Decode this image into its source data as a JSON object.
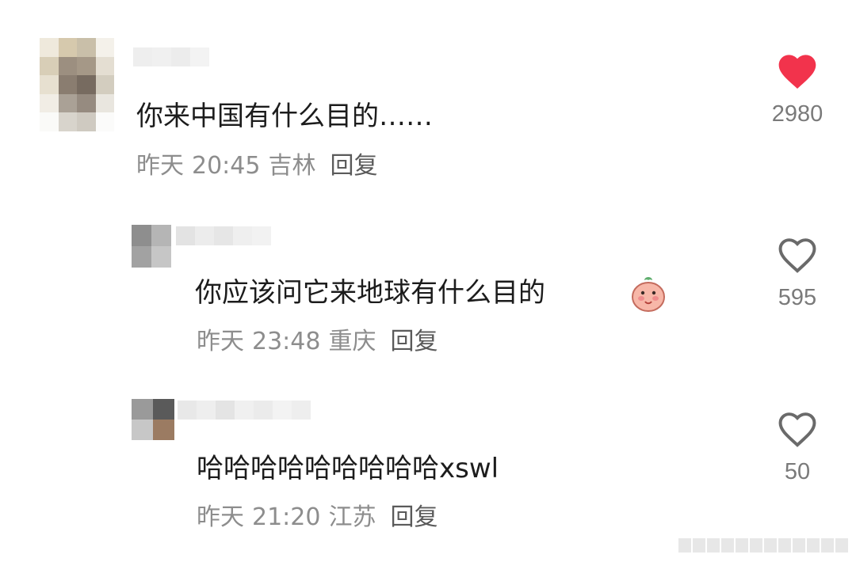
{
  "comments": [
    {
      "text": "你来中国有什么目的……",
      "date": "昨天",
      "time": "20:45",
      "location": "吉林",
      "reply_label": "回复",
      "likes": "2980",
      "liked": true
    },
    {
      "text": "你应该问它来地球有什么目的",
      "date": "昨天",
      "time": "23:48",
      "location": "重庆",
      "reply_label": "回复",
      "likes": "595",
      "liked": false,
      "emoji": "peach-blush-emoji"
    },
    {
      "text": "哈哈哈哈哈哈哈哈哈xswl",
      "date": "昨天",
      "time": "21:20",
      "location": "江苏",
      "reply_label": "回复",
      "likes": "50",
      "liked": false
    }
  ],
  "icons": {
    "liked": "heart-filled-icon",
    "unliked": "heart-outline-icon"
  },
  "colors": {
    "liked_heart": "#f2334c",
    "outline_heart": "#6a6a6a",
    "meta_text": "#8d8d8d",
    "body_text": "#1c1c1c"
  }
}
